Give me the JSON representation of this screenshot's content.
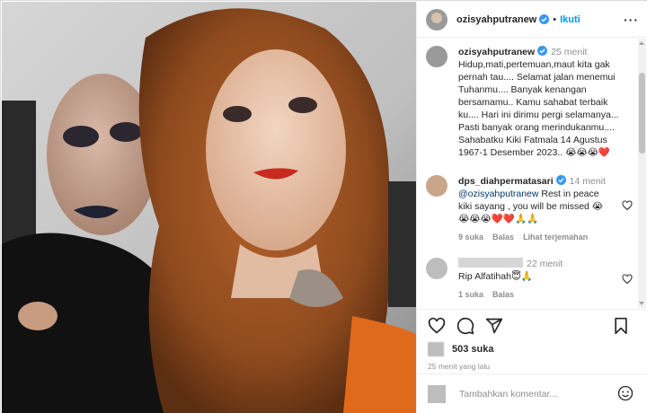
{
  "post": {
    "author": "ozisyahputranew",
    "separator": "•",
    "follow_label": "Ikuti",
    "more_label": "···"
  },
  "caption": {
    "author": "ozisyahputranew",
    "time": "25 menit",
    "lines": [
      "Hidup,mati,pertemuan,maut kita gak",
      "pernah tau.... Selamat jalan menemui",
      "Tuhanmu.... Banyak kenangan",
      "bersamamu.. Kamu sahabat terbaik",
      "ku.... Hari ini dirimu pergi selamanya...",
      "Pasti banyak orang merindukanmu....",
      "Sahabatku Kiki Fatmala 14 Agustus",
      "1967-1 Desember 2023.. 😭😭😭❤️"
    ]
  },
  "comments": [
    {
      "author": "dps_diahpermatasari",
      "time": "14 menit",
      "mention": "@ozisyahputranew",
      "lines_after_mention": [
        " Rest in peace",
        "kiki sayang , you will be missed 😭",
        "😭😭😭❤️❤️🙏🙏"
      ],
      "likes": "9 suka",
      "reply": "Balas",
      "translate": "Lihat terjemahan"
    },
    {
      "author": "",
      "time": "22 menit",
      "text": "Rip Alfatihah😇🙏",
      "likes": "1 suka",
      "reply": "Balas"
    }
  ],
  "actions": {
    "likes_count": "503 suka",
    "posted_ago": "25 menit yang lalu",
    "comment_placeholder": "Tambahkan komentar..."
  },
  "colors": {
    "accent": "#0095f6",
    "verified": "#3897f0",
    "heart": "#ed4956"
  }
}
